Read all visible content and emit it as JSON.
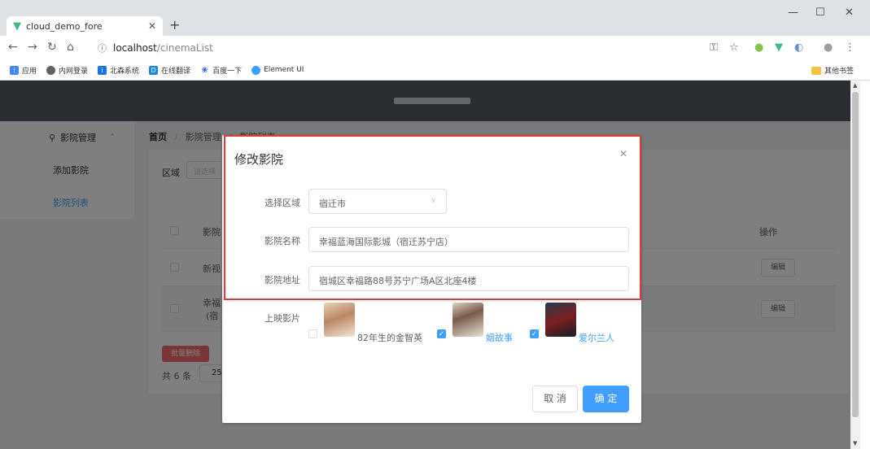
{
  "browser": {
    "tab_title": "cloud_demo_fore",
    "url_host": "localhost",
    "url_path": "/cinemaList",
    "bookmarks": [
      {
        "label": "应用",
        "color": "#4285f4"
      },
      {
        "label": "内网登录",
        "color": "#5f6368"
      },
      {
        "label": "北森系统",
        "color": "#1a73e8"
      },
      {
        "label": "在线翻译",
        "color": "#1e88e5"
      },
      {
        "label": "百度一下",
        "color": "#2962ff"
      },
      {
        "label": "Element UI",
        "color": "#409eff"
      }
    ],
    "other_bookmarks": "其他书签"
  },
  "sidebar": {
    "parent": "影院管理",
    "items": [
      "添加影院",
      "影院列表"
    ]
  },
  "breadcrumb": {
    "home": "首页",
    "section": "影院管理",
    "current": "影院列表"
  },
  "filter": {
    "label": "区域",
    "placeholder": "请选择"
  },
  "table": {
    "header_name": "影院",
    "header_op": "操作",
    "rows": [
      {
        "name": "新视"
      },
      {
        "name": "幸福",
        "sub": "(宿"
      }
    ],
    "edit_label": "编辑",
    "batch_delete": "批量删除",
    "total": "共 6 条",
    "page_size": "25"
  },
  "dialog": {
    "title": "修改影院",
    "region_label": "选择区域",
    "region_value": "宿迁市",
    "name_label": "影院名称",
    "name_value": "幸福蓝海国际影城（宿迁苏宁店）",
    "address_label": "影院地址",
    "address_value": "宿城区幸福路88号苏宁广场A区北座4楼",
    "movies_label": "上映影片",
    "movies": [
      {
        "name": "82年生的金智英",
        "checked": false
      },
      {
        "name": "姻故事",
        "checked": true
      },
      {
        "name": "爱尔兰人",
        "checked": true
      }
    ],
    "cancel": "取 消",
    "confirm": "确 定"
  },
  "colors": {
    "primary": "#409eff",
    "danger": "#f56c6c",
    "topbar": "#545c64",
    "highlight": "#e53935"
  }
}
